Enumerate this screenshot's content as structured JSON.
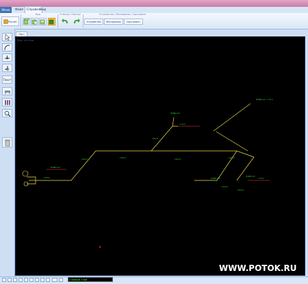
{
  "app": {
    "menu_button": "Меню"
  },
  "tabs": [
    {
      "label": "Файл"
    },
    {
      "label": "Справка"
    },
    {
      "label": "Вид"
    }
  ],
  "ribbon": {
    "group_view": "Вид",
    "group_objects": "Отмена / Повтор",
    "group_devices": "Устройства / Материалы / Сортамент",
    "calculate_button": "Расчёт",
    "devices_button": "Устройства",
    "materials_button": "Материалы",
    "assortment_button": "Сортамент"
  },
  "tools": {
    "text_tool": "Текст"
  },
  "sheet": {
    "tab_label": "Лист",
    "canvas_caption": "Вид: по осям"
  },
  "drawing": {
    "callout_label": "Ф108×4,0",
    "dims": "110×4",
    "note": "ст.3сп"
  },
  "status": {
    "layer": "Главный слой"
  },
  "watermark": "WWW.POTOK.RU",
  "colors": {
    "pipe": "#f2e14a",
    "label": "#2fe22f",
    "dim_line": "#ff3b3b",
    "canvas_bg": "#000000",
    "title_bar": "#c47fa8"
  }
}
